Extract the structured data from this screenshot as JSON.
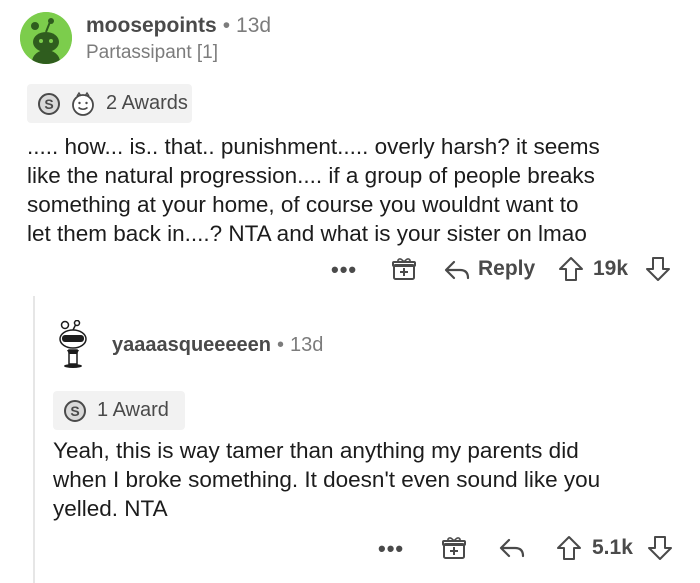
{
  "comment1": {
    "username": "moosepoints",
    "separator": "•",
    "age": "13d",
    "flair": "Partassipant [1]",
    "awards_label": "2 Awards",
    "body_lines": [
      "..... how... is.. that.. punishment..... overly harsh? it seems",
      "like the natural progression.... if a group of people breaks",
      "something at your home, of course you wouldnt want to",
      "let them back in....? NTA and what is your sister on lmao"
    ],
    "more_label": "•••",
    "reply_label": "Reply",
    "vote_count": "19k"
  },
  "comment2": {
    "username": "yaaaasqueeeeen",
    "separator": "•",
    "age": "13d",
    "awards_label": "1 Award",
    "body_lines": [
      "Yeah, this is way tamer than anything my parents did",
      "when I broke something. It doesn't even sound like you",
      "yelled. NTA"
    ],
    "more_label": "•••",
    "vote_count": "5.1k"
  },
  "colors": {
    "avatar_green": "#7ccd4c",
    "text_primary": "#1c1c1c",
    "text_secondary": "#7c7c7c",
    "icon_gray": "#4a4a4a",
    "award_bg": "#f2f2f2"
  }
}
